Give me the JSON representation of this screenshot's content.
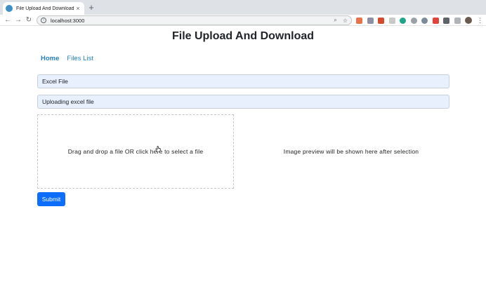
{
  "browser": {
    "tab_title": "File Upload And Download",
    "tab_close": "×",
    "new_tab": "+",
    "url": "localhost:3000",
    "back": "←",
    "forward": "→",
    "reload": "↻"
  },
  "app": {
    "title": "File Upload And Download",
    "nav": [
      {
        "label": "Home",
        "active": true
      },
      {
        "label": "Files List",
        "active": false
      }
    ],
    "fields": [
      {
        "value": "Excel File"
      },
      {
        "value": "Uploading excel file"
      }
    ],
    "dropzone_text": "Drag and drop a file OR click here to select a file",
    "preview_text": "Image preview will be shown here after selection",
    "submit_label": "Submit"
  },
  "colors": {
    "accent": "#0d6efd",
    "link": "#2680c2",
    "field_bg": "#e8f0fe"
  }
}
